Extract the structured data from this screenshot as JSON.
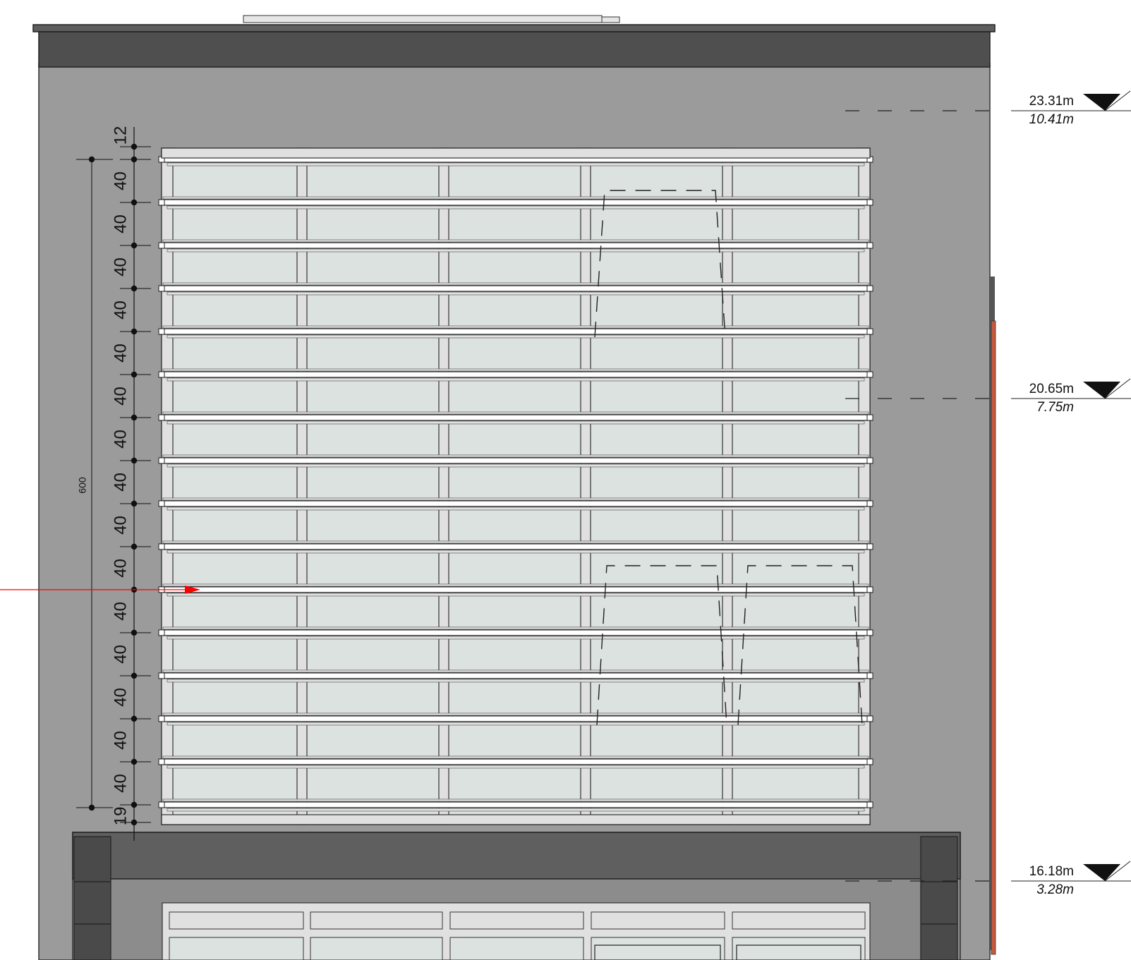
{
  "dimensions": {
    "overall": "600",
    "top_segment": "12",
    "bottom_segment": "19",
    "segments": [
      "40",
      "40",
      "40",
      "40",
      "40",
      "40",
      "40",
      "40",
      "40",
      "40",
      "40",
      "40",
      "40",
      "40",
      "40"
    ]
  },
  "levels": [
    {
      "absolute": "23.31m",
      "relative": "10.41m"
    },
    {
      "absolute": "20.65m",
      "relative": "7.75m"
    },
    {
      "absolute": "16.18m",
      "relative": "3.28m"
    }
  ],
  "colors": {
    "wall": "#9b9b9b",
    "parapet": "#4f4f4f",
    "glass": "#dbe2df",
    "frame": "#e0e0e0",
    "brick": "#c85a3c",
    "section_marker": "#ff0000"
  }
}
